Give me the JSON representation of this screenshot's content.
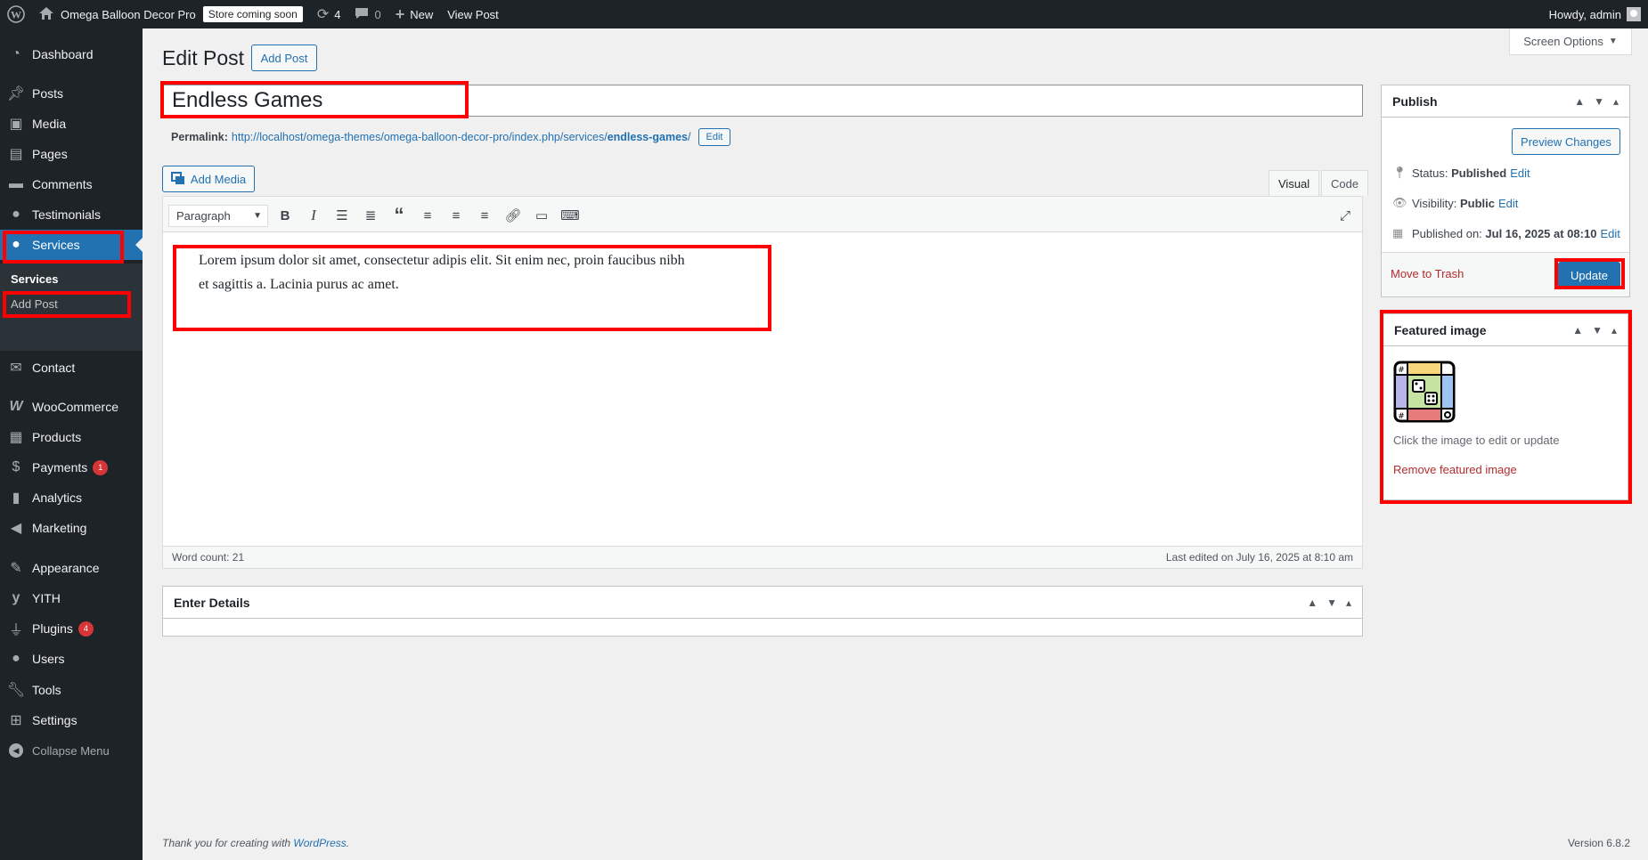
{
  "adminbar": {
    "site_name": "Omega Balloon Decor Pro",
    "coming_soon": "Store coming soon",
    "updates_count": "4",
    "comments_count": "0",
    "new_label": "New",
    "view_post_label": "View Post",
    "howdy": "Howdy, admin"
  },
  "sidebar": {
    "items": [
      {
        "label": "Dashboard",
        "icon": "dashboard-icon"
      },
      {
        "label": "Posts",
        "icon": "pin-icon"
      },
      {
        "label": "Media",
        "icon": "media-icon"
      },
      {
        "label": "Pages",
        "icon": "pages-icon"
      },
      {
        "label": "Comments",
        "icon": "comment-icon"
      },
      {
        "label": "Testimonials",
        "icon": "user-icon"
      },
      {
        "label": "Services",
        "icon": "user-icon"
      },
      {
        "label": "Contact",
        "icon": "envelope-icon"
      },
      {
        "label": "WooCommerce",
        "icon": "woo-icon"
      },
      {
        "label": "Products",
        "icon": "archive-icon"
      },
      {
        "label": "Payments",
        "icon": "dollar-icon",
        "badge": "1"
      },
      {
        "label": "Analytics",
        "icon": "bar-chart-icon"
      },
      {
        "label": "Marketing",
        "icon": "megaphone-icon"
      },
      {
        "label": "Appearance",
        "icon": "brush-icon"
      },
      {
        "label": "YITH",
        "icon": "yith-icon"
      },
      {
        "label": "Plugins",
        "icon": "plugin-icon",
        "badge": "4"
      },
      {
        "label": "Users",
        "icon": "user-icon"
      },
      {
        "label": "Tools",
        "icon": "wrench-icon"
      },
      {
        "label": "Settings",
        "icon": "settings-icon"
      }
    ],
    "submenu_head": "Services",
    "submenu_item": "Add Post",
    "collapse_label": "Collapse Menu"
  },
  "page": {
    "title": "Edit Post",
    "add_post_label": "Add Post",
    "screen_options": "Screen Options"
  },
  "post": {
    "title_value": "Endless Games",
    "permalink_label": "Permalink:",
    "permalink_base": "http://localhost/omega-themes/omega-balloon-decor-pro/index.php/services/",
    "permalink_slug": "endless-games",
    "permalink_end": "/",
    "permalink_edit": "Edit",
    "add_media": "Add Media",
    "tab_visual": "Visual",
    "tab_code": "Code",
    "format": "Paragraph",
    "content": "Lorem ipsum dolor sit amet, consectetur adipis elit. Sit enim nec, proin faucibus nibh et sagittis a. Lacinia purus ac amet.",
    "word_count": "Word count: 21",
    "last_edited": "Last edited on July 16, 2025 at 8:10 am"
  },
  "details": {
    "title": "Enter Details"
  },
  "publish": {
    "title": "Publish",
    "preview": "Preview Changes",
    "status_label": "Status:",
    "status_value": "Published",
    "visibility_label": "Visibility:",
    "visibility_value": "Public",
    "published_label": "Published on:",
    "published_value": "Jul 16, 2025 at 08:10",
    "edit": "Edit",
    "trash": "Move to Trash",
    "update": "Update"
  },
  "featured": {
    "title": "Featured image",
    "hint": "Click the image to edit or update",
    "remove": "Remove featured image"
  },
  "footer": {
    "thanks_prefix": "Thank you for creating with",
    "wp_link": "WordPress",
    "thanks_suffix": ".",
    "version": "Version 6.8.2"
  },
  "colors": {
    "accent": "#2271b1",
    "sidebar_bg": "#1d2327",
    "highlight": "#ff0000",
    "danger": "#b32d2e"
  }
}
